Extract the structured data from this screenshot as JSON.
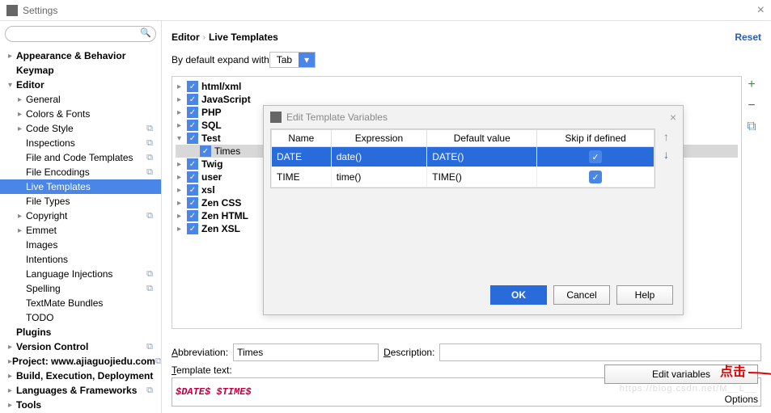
{
  "window": {
    "title": "Settings",
    "close": "×"
  },
  "search": {
    "placeholder": ""
  },
  "sidebar": {
    "items": [
      {
        "label": "Appearance & Behavior",
        "arrow": "▸",
        "bold": true,
        "lvl": 1
      },
      {
        "label": "Keymap",
        "arrow": "",
        "bold": true,
        "lvl": 1
      },
      {
        "label": "Editor",
        "arrow": "▾",
        "bold": true,
        "lvl": 1
      },
      {
        "label": "General",
        "arrow": "▸",
        "lvl": 2
      },
      {
        "label": "Colors & Fonts",
        "arrow": "▸",
        "lvl": 2
      },
      {
        "label": "Code Style",
        "arrow": "▸",
        "lvl": 2,
        "copy": true
      },
      {
        "label": "Inspections",
        "arrow": "",
        "lvl": 2,
        "copy": true
      },
      {
        "label": "File and Code Templates",
        "arrow": "",
        "lvl": 2,
        "copy": true
      },
      {
        "label": "File Encodings",
        "arrow": "",
        "lvl": 2,
        "copy": true
      },
      {
        "label": "Live Templates",
        "arrow": "",
        "lvl": 2,
        "selected": true
      },
      {
        "label": "File Types",
        "arrow": "",
        "lvl": 2
      },
      {
        "label": "Copyright",
        "arrow": "▸",
        "lvl": 2,
        "copy": true
      },
      {
        "label": "Emmet",
        "arrow": "▸",
        "lvl": 2
      },
      {
        "label": "Images",
        "arrow": "",
        "lvl": 2
      },
      {
        "label": "Intentions",
        "arrow": "",
        "lvl": 2
      },
      {
        "label": "Language Injections",
        "arrow": "",
        "lvl": 2,
        "copy": true
      },
      {
        "label": "Spelling",
        "arrow": "",
        "lvl": 2,
        "copy": true
      },
      {
        "label": "TextMate Bundles",
        "arrow": "",
        "lvl": 2
      },
      {
        "label": "TODO",
        "arrow": "",
        "lvl": 2
      },
      {
        "label": "Plugins",
        "arrow": "",
        "bold": true,
        "lvl": 1
      },
      {
        "label": "Version Control",
        "arrow": "▸",
        "bold": true,
        "lvl": 1,
        "copy": true
      },
      {
        "label": "Project: www.ajiaguojiedu.com",
        "arrow": "▸",
        "bold": true,
        "lvl": 1,
        "copy": true
      },
      {
        "label": "Build, Execution, Deployment",
        "arrow": "▸",
        "bold": true,
        "lvl": 1
      },
      {
        "label": "Languages & Frameworks",
        "arrow": "▸",
        "bold": true,
        "lvl": 1,
        "copy": true
      },
      {
        "label": "Tools",
        "arrow": "▸",
        "bold": true,
        "lvl": 1
      }
    ]
  },
  "breadcrumb": {
    "parts": [
      "Editor",
      "Live Templates"
    ],
    "reset": "Reset"
  },
  "expand": {
    "label": "By default expand with",
    "value": "Tab"
  },
  "templates": {
    "groups": [
      {
        "name": "html/xml",
        "arrow": "▸"
      },
      {
        "name": "JavaScript",
        "arrow": "▸"
      },
      {
        "name": "PHP",
        "arrow": "▸"
      },
      {
        "name": "SQL",
        "arrow": "▸"
      },
      {
        "name": "Test",
        "arrow": "▾",
        "children": [
          {
            "name": "Times",
            "selected": true
          }
        ]
      },
      {
        "name": "Twig",
        "arrow": "▸"
      },
      {
        "name": "user",
        "arrow": "▸"
      },
      {
        "name": "xsl",
        "arrow": "▸"
      },
      {
        "name": "Zen CSS",
        "arrow": "▸"
      },
      {
        "name": "Zen HTML",
        "arrow": "▸"
      },
      {
        "name": "Zen XSL",
        "arrow": "▸"
      }
    ]
  },
  "toolbar": {
    "add": "+",
    "remove": "−",
    "copy": "⧉"
  },
  "form": {
    "abbr_label": "Abbreviation:",
    "abbr_value": "Times",
    "desc_label": "Description:",
    "desc_value": "",
    "tpl_label": "Template text:",
    "tpl_value": "$DATE$ $TIME$",
    "edit_vars": "Edit variables",
    "options": "Options"
  },
  "annotation": "点击",
  "watermark": "https://blog.csdn.net/M__L__",
  "dialog": {
    "title": "Edit Template Variables",
    "close": "×",
    "cols": [
      "Name",
      "Expression",
      "Default value",
      "Skip if defined"
    ],
    "rows": [
      {
        "name": "DATE",
        "expr": "date()",
        "def": "DATE()",
        "skip": true,
        "sel": true
      },
      {
        "name": "TIME",
        "expr": "time()",
        "def": "TIME()",
        "skip": true
      }
    ],
    "buttons": {
      "ok": "OK",
      "cancel": "Cancel",
      "help": "Help"
    }
  }
}
